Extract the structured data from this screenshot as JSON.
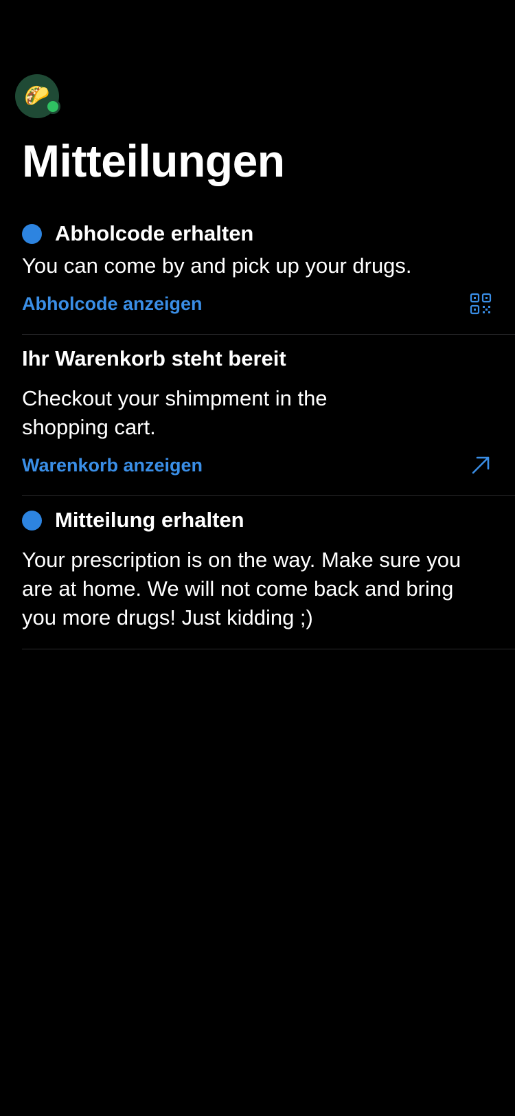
{
  "header": {
    "avatar_icon": "taco-icon",
    "avatar_emoji": "🌮",
    "status_color": "#2fc262",
    "title": "Mitteilungen"
  },
  "colors": {
    "background": "#000000",
    "accent": "#3a8ee6",
    "unread_dot": "#2d84e0"
  },
  "notifications": [
    {
      "unread": true,
      "title": "Abholcode erhalten",
      "body": "You can come by and pick up your drugs.",
      "action_label": "Abholcode anzeigen",
      "action_icon": "qr-code-icon"
    },
    {
      "unread": false,
      "title": "Ihr Warenkorb steht bereit",
      "body": "Checkout your shimpment in the shopping cart.",
      "action_label": "Warenkorb anzeigen",
      "action_icon": "arrow-up-right-icon"
    },
    {
      "unread": true,
      "title": "Mitteilung erhalten",
      "body": "Your prescription is on the way. Make sure you are at home. We will not come back and bring you more drugs! Just kidding ;)"
    }
  ]
}
